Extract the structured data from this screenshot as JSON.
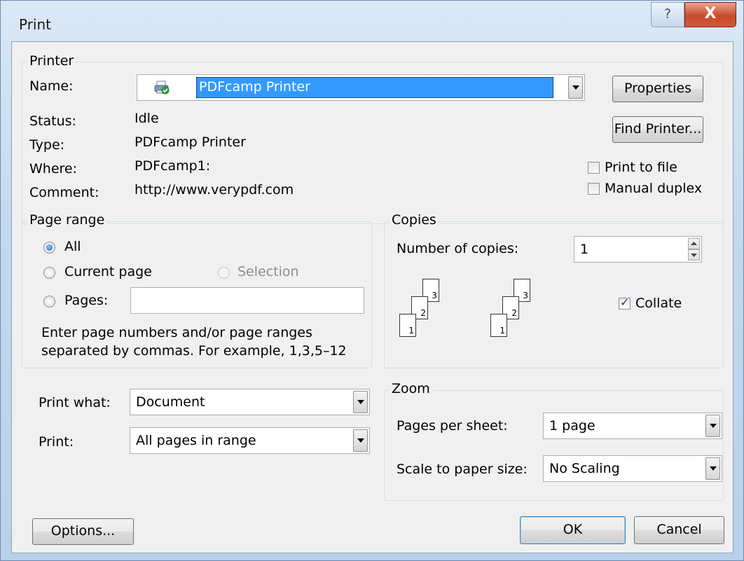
{
  "window": {
    "title": "Print",
    "help_label": "?",
    "close_label": "X"
  },
  "printer": {
    "group_label": "Printer",
    "name_label": "Name:",
    "name_value": "PDFcamp Printer",
    "status_label": "Status:",
    "status_value": "Idle",
    "type_label": "Type:",
    "type_value": "PDFcamp Printer",
    "where_label": "Where:",
    "where_value": "PDFcamp1:",
    "comment_label": "Comment:",
    "comment_value": "http://www.verypdf.com",
    "properties_button": "Properties",
    "find_printer_button": "Find Printer...",
    "print_to_file_label": "Print to file",
    "print_to_file_checked": false,
    "manual_duplex_label": "Manual duplex",
    "manual_duplex_checked": false
  },
  "page_range": {
    "group_label": "Page range",
    "all_label": "All",
    "current_page_label": "Current page",
    "selection_label": "Selection",
    "pages_label": "Pages:",
    "pages_value": "",
    "selected": "All",
    "hint_line1": "Enter page numbers and/or page ranges",
    "hint_line2": "separated by commas.  For example, 1,3,5–12"
  },
  "copies": {
    "group_label": "Copies",
    "number_label": "Number of copies:",
    "number_value": "1",
    "collate_label": "Collate",
    "collate_checked": true,
    "page_numbers": [
      "1",
      "2",
      "3"
    ]
  },
  "print_what": {
    "label": "Print what:",
    "value": "Document"
  },
  "print": {
    "label": "Print:",
    "value": "All pages in range"
  },
  "zoom": {
    "group_label": "Zoom",
    "pages_per_sheet_label": "Pages per sheet:",
    "pages_per_sheet_value": "1 page",
    "scale_label": "Scale to paper size:",
    "scale_value": "No Scaling"
  },
  "buttons": {
    "options": "Options...",
    "ok": "OK",
    "cancel": "Cancel"
  }
}
